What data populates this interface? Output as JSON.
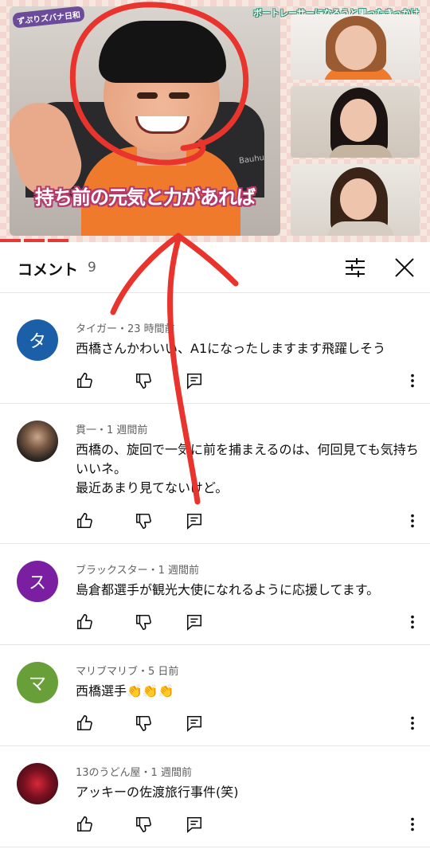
{
  "video": {
    "badge": "ずぷりズバナ日和",
    "topic": "ボートレーサーになろうと思ったきっかけ",
    "caption": "持ち前の元気と力があれば",
    "chair_brand": "Bauhutte"
  },
  "comments_panel": {
    "title": "コメント",
    "count": "9",
    "sort_icon": "sort-icon",
    "close_icon": "close-icon"
  },
  "comments": [
    {
      "author": "タイガー・23 時間前",
      "avatar_letter": "タ",
      "avatar_color": "#1a5fa8",
      "lines": [
        "西橋さんかわいい、A1になったしますます飛躍しそう"
      ]
    },
    {
      "author": "貫一・1 週間前",
      "avatar_letter": "",
      "avatar_color": "#3a3a3a",
      "lines": [
        "西橋の、旋回で一気に前を捕まえるのは、何回見ても気持ち",
        "いいネ。",
        "最近あまり見てないけど。"
      ]
    },
    {
      "author": "ブラックスター・1 週間前",
      "avatar_letter": "ス",
      "avatar_color": "#7b1fa2",
      "lines": [
        "島倉都選手が観光大使になれるように応援してます。"
      ]
    },
    {
      "author": "マリブマリブ・5 日前",
      "avatar_letter": "マ",
      "avatar_color": "#689f38",
      "lines": [
        "西橋選手👏👏👏"
      ]
    },
    {
      "author": "13のうどん屋・1 週間前",
      "avatar_letter": "",
      "avatar_color": "#5a2a1a",
      "lines": [
        "アッキーの佐渡旅行事件(笑)"
      ]
    }
  ],
  "action_icons": {
    "like": "thumbs-up-icon",
    "dislike": "thumbs-down-icon",
    "reply": "reply-icon",
    "more": "more-vert-icon"
  },
  "colors": {
    "annotation_red": "#e8342c",
    "caption_outline": "#b53a6a",
    "progress": "#e53935"
  }
}
